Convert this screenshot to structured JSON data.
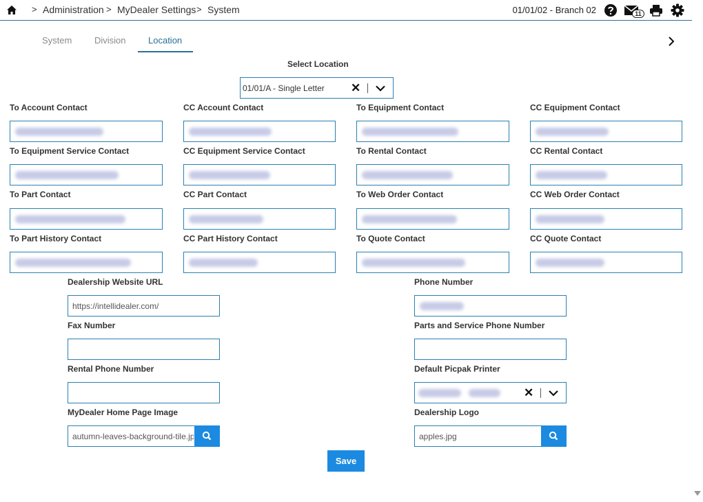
{
  "breadcrumb": {
    "sep": ">",
    "items": [
      "Administration",
      "MyDealer Settings",
      "System"
    ]
  },
  "header": {
    "branch": "01/01/02 - Branch 02",
    "mail_count": "11",
    "icons": [
      "home-icon",
      "help-icon",
      "mail-icon",
      "print-icon",
      "gear-icon"
    ]
  },
  "tabs": [
    {
      "label": "System",
      "active": false
    },
    {
      "label": "Division",
      "active": false
    },
    {
      "label": "Location",
      "active": true
    }
  ],
  "select_location": {
    "label": "Select Location",
    "value": "01/01/A - Single Letter"
  },
  "contacts": [
    {
      "label": "To Account Contact"
    },
    {
      "label": "CC Account Contact"
    },
    {
      "label": "To Equipment Contact"
    },
    {
      "label": "CC Equipment Contact"
    },
    {
      "label": "To Equipment Service Contact"
    },
    {
      "label": "CC Equipment Service Contact"
    },
    {
      "label": "To Rental Contact"
    },
    {
      "label": "CC Rental Contact"
    },
    {
      "label": "To Part Contact"
    },
    {
      "label": "CC Part Contact"
    },
    {
      "label": "To Web Order Contact"
    },
    {
      "label": "CC Web Order Contact"
    },
    {
      "label": "To Part History Contact"
    },
    {
      "label": "CC Part History Contact"
    },
    {
      "label": "To Quote Contact"
    },
    {
      "label": "CC Quote Contact"
    }
  ],
  "dealership": {
    "website_label": "Dealership Website URL",
    "website_value": "https://intellidealer.com/",
    "phone_label": "Phone Number",
    "fax_label": "Fax Number",
    "fax_value": "",
    "parts_phone_label": "Parts and Service Phone Number",
    "parts_phone_value": "",
    "rental_phone_label": "Rental Phone Number",
    "rental_phone_value": "",
    "printer_label": "Default Picpak Printer",
    "home_image_label": "MyDealer Home Page Image",
    "home_image_value": "autumn-leaves-background-tile.jpg",
    "logo_label": "Dealership Logo",
    "logo_value": "apples.jpg"
  },
  "save_label": "Save",
  "colors": {
    "accent": "#2a6f97",
    "button": "#1b8ae0",
    "field_border": "#2a7fb0"
  }
}
